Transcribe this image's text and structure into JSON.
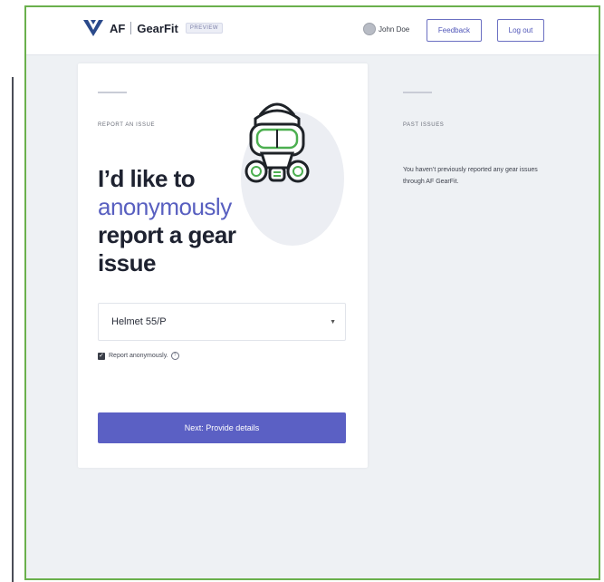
{
  "header": {
    "brand_af": "AF",
    "brand_name": "GearFit",
    "brand_badge": "PREVIEW",
    "user_name": "John Doe",
    "feedback_label": "Feedback",
    "logout_label": "Log out"
  },
  "report": {
    "eyebrow": "REPORT AN ISSUE",
    "title_line1": "I’d like to",
    "title_accent": "anonymously",
    "title_line3": "report a gear",
    "title_line4": "issue",
    "select_value": "Helmet 55/P",
    "anonymous_label": "Report anonymously.",
    "anonymous_checked": true,
    "next_label": "Next: Provide details"
  },
  "past": {
    "eyebrow": "PAST ISSUES",
    "text": "You haven’t previously reported any gear issues through AF GearFit."
  },
  "colors": {
    "accent": "#5b60c4",
    "frame_border": "#6ab04c",
    "background": "#eef1f4"
  }
}
